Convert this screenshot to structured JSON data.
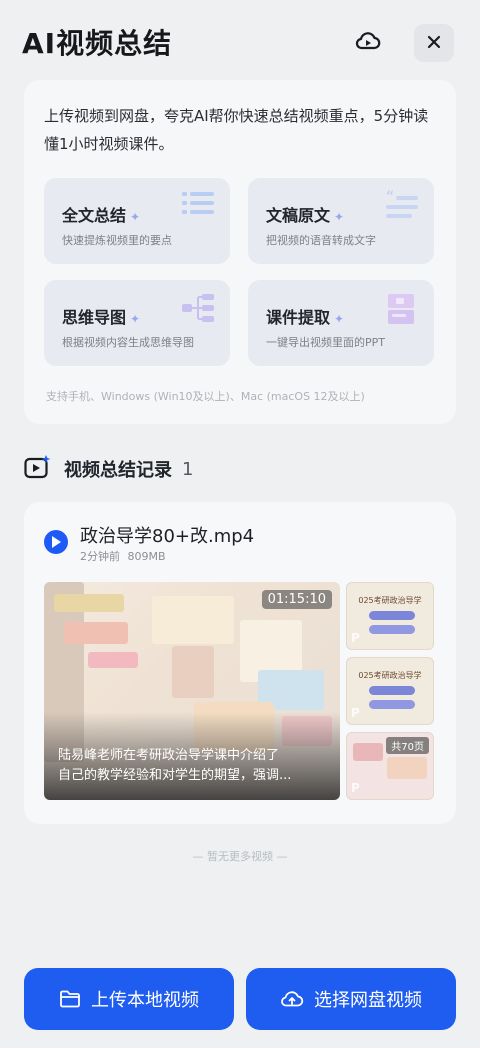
{
  "header": {
    "title": "AI视频总结"
  },
  "intro": {
    "text": "上传视频到网盘，夸克AI帮你快速总结视频重点，5分钟读懂1小时视频课件。",
    "features": [
      {
        "title": "全文总结",
        "desc": "快速提炼视频里的要点",
        "icon": "list-icon"
      },
      {
        "title": "文稿原文",
        "desc": "把视频的语音转成文字",
        "icon": "quote-icon"
      },
      {
        "title": "思维导图",
        "desc": "根据视频内容生成思维导图",
        "icon": "mindmap-icon"
      },
      {
        "title": "课件提取",
        "desc": "一键导出视频里面的PPT",
        "icon": "slides-icon"
      }
    ],
    "spark": "✦",
    "support": "支持手机、Windows (Win10及以上)、Mac (macOS 12及以上)"
  },
  "records": {
    "title": "视频总结记录",
    "count": "1",
    "item": {
      "filename": "政治导学80+改.mp4",
      "time": "2分钟前",
      "size": "809MB",
      "duration": "01:15:10",
      "caption_line1": "陆易峰老师在考研政治导学课中介绍了",
      "caption_line2": "自己的教学经验和对学生的期望，强调...",
      "slides": [
        {
          "title": "025考研政治导学"
        },
        {
          "title": "025考研政治导学"
        },
        {
          "title": ""
        }
      ],
      "pages_badge": "共70页"
    }
  },
  "footer": {
    "no_more": "— 暂无更多视频 —",
    "upload_local": "上传本地视频",
    "choose_cloud": "选择网盘视频"
  },
  "colors": {
    "accent": "#1f5cf0",
    "background": "#eef0f2"
  }
}
